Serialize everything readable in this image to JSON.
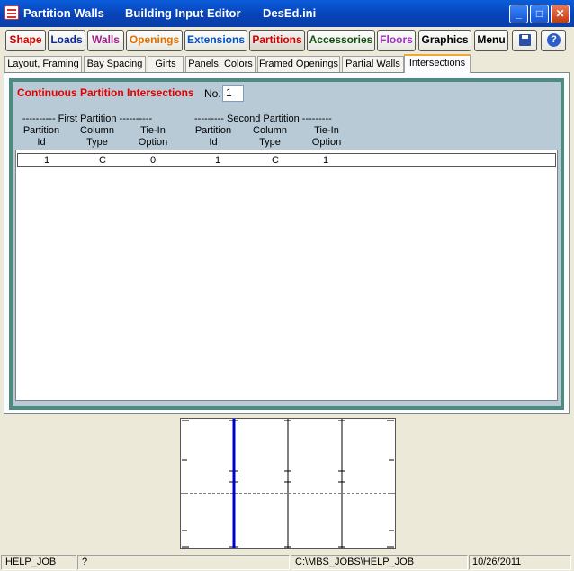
{
  "window": {
    "title": "Partition Walls",
    "subtitle": "Building Input Editor",
    "file": "DesEd.ini",
    "minimize": "_",
    "maximize": "□",
    "close": "✕"
  },
  "toolbar": {
    "buttons": [
      {
        "label": "Shape",
        "color": "#d00000"
      },
      {
        "label": "Loads",
        "color": "#0a2a9a"
      },
      {
        "label": "Walls",
        "color": "#a0208a"
      },
      {
        "label": "Openings",
        "color": "#e07000"
      },
      {
        "label": "Extensions",
        "color": "#0050c8"
      },
      {
        "label": "Partitions",
        "color": "#d00000"
      },
      {
        "label": "Accessories",
        "color": "#105010"
      },
      {
        "label": "Floors",
        "color": "#a030c0"
      },
      {
        "label": "Graphics",
        "color": "#000000"
      },
      {
        "label": "Menu",
        "color": "#000000"
      }
    ],
    "save_icon": "save-icon",
    "help_icon": "help-icon",
    "help_glyph": "?"
  },
  "tabs": [
    "Layout, Framing",
    "Bay Spacing",
    "Girts",
    "Panels, Colors",
    "Framed Openings",
    "Partial Walls",
    "Intersections"
  ],
  "section": {
    "title": "Continuous Partition Intersections",
    "no_label": "No.",
    "no_value": "1"
  },
  "table": {
    "group1": "---------- First Partition ----------",
    "group2": "--------- Second Partition ---------",
    "headers": [
      [
        "Partition",
        "Id"
      ],
      [
        "Column",
        "Type"
      ],
      [
        "Tie-In",
        "Option"
      ],
      [
        "Partition",
        "Id"
      ],
      [
        "Column",
        "Type"
      ],
      [
        "Tie-In",
        "Option"
      ]
    ],
    "rows": [
      [
        "1",
        "C",
        "0",
        "1",
        "C",
        "1"
      ]
    ]
  },
  "status": {
    "job": "HELP_JOB",
    "help": "?",
    "path": "C:\\MBS_JOBS\\HELP_JOB",
    "date": "10/26/2011"
  },
  "colors": {
    "accent_title": "#e00000",
    "panel_frame": "#4d8a80",
    "panel_bg": "#b8cad6",
    "highlight_partition": "#0000cc"
  }
}
